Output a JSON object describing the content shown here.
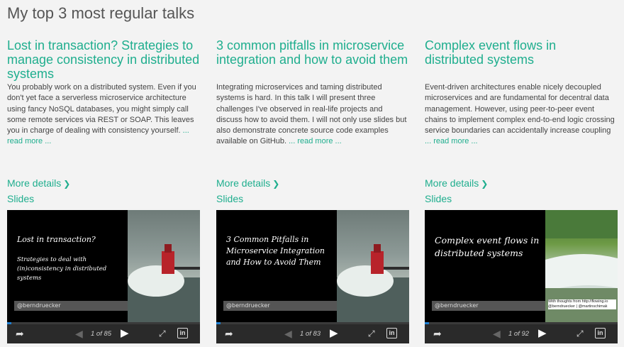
{
  "page": {
    "title": "My top 3 most regular talks"
  },
  "talks": [
    {
      "title": "Lost in transaction? Strategies to manage consistency in distributed systems",
      "description": "You probably work on a distributed system. Even if you don't yet face a serverless microservice architecture using fancy NoSQL databases, you might simply call some remote services via REST or SOAP. This leaves you in charge of dealing with consistency yourself.",
      "read_more": "... read more ...",
      "more_details": "More details",
      "slides_label": "Slides",
      "slide_main": "Lost in transaction?",
      "slide_sub": "Strategies to deal with (in)consistency in distributed systems",
      "slide_handle": "@berndruecker",
      "slide_credit": "",
      "counter": "1 of 85"
    },
    {
      "title": "3 common pitfalls in microservice integration and how to avoid them",
      "description": "Integrating microservices and taming distributed systems is hard. In this talk I will present three challenges I've observed in real-life projects and discuss how to avoid them. I will not only use slides but also demonstrate concrete source code examples available on GitHub.",
      "read_more": "... read more ...",
      "more_details": "More details",
      "slides_label": "Slides",
      "slide_main": "3 Common Pitfalls in Microservice Integration and How to Avoid Them",
      "slide_sub": "",
      "slide_handle": "@berndruecker",
      "slide_credit": "",
      "counter": "1 of 83"
    },
    {
      "title": "Complex event flows in distributed systems",
      "description": "Event-driven architectures enable nicely decoupled microservices and are fundamental for decentral data management. However, using peer-to-peer event chains to implement complex end-to-end logic crossing service boundaries can accidentally increase coupling",
      "read_more": "... read more ...",
      "more_details": "More details",
      "slides_label": "Slides",
      "slide_main": "Complex event flows in distributed systems",
      "slide_sub": "",
      "slide_handle": "@berndruecker",
      "slide_credit": "With thoughts from http://flowing.io @berndruecker | @martinschimak",
      "counter": "1 of 92"
    }
  ],
  "icons": {
    "share": "share-icon",
    "prev": "prev-slide-icon",
    "next": "next-slide-icon",
    "fullscreen": "fullscreen-icon",
    "linkedin": "linkedin-icon"
  },
  "colors": {
    "accent": "#1fae8e",
    "progress": "#1e7fd3"
  }
}
